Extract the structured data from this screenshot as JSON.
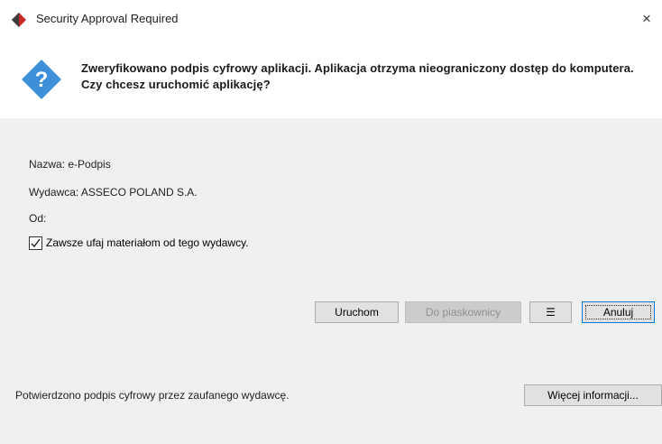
{
  "window": {
    "title": "Security Approval Required",
    "close_glyph": "×"
  },
  "header": {
    "message": "Zweryfikowano podpis cyfrowy aplikacji. Aplikacja otrzyma nieograniczony dostęp do komputera. Czy chcesz uruchomić aplikację?",
    "icon": "question-shield-icon"
  },
  "details": {
    "name_line": "Nazwa:  e-Podpis",
    "publisher_line": "Wydawca: ASSECO POLAND S.A.",
    "from_line": "Od:",
    "trust_checkbox": {
      "label": "Zawsze ufaj materiałom od tego wydawcy.",
      "checked": true
    }
  },
  "buttons": {
    "run": "Uruchom",
    "sandbox": "Do piaskownicy",
    "menu": "☰",
    "cancel": "Anuluj",
    "more_info": "Więcej informacji..."
  },
  "footer": {
    "status": "Potwierdzono podpis cyfrowy przez zaufanego wydawcę."
  },
  "colors": {
    "accent": "#0078d7",
    "icon_blue": "#3c8fd8",
    "panel_bg": "#f0f0f0"
  }
}
